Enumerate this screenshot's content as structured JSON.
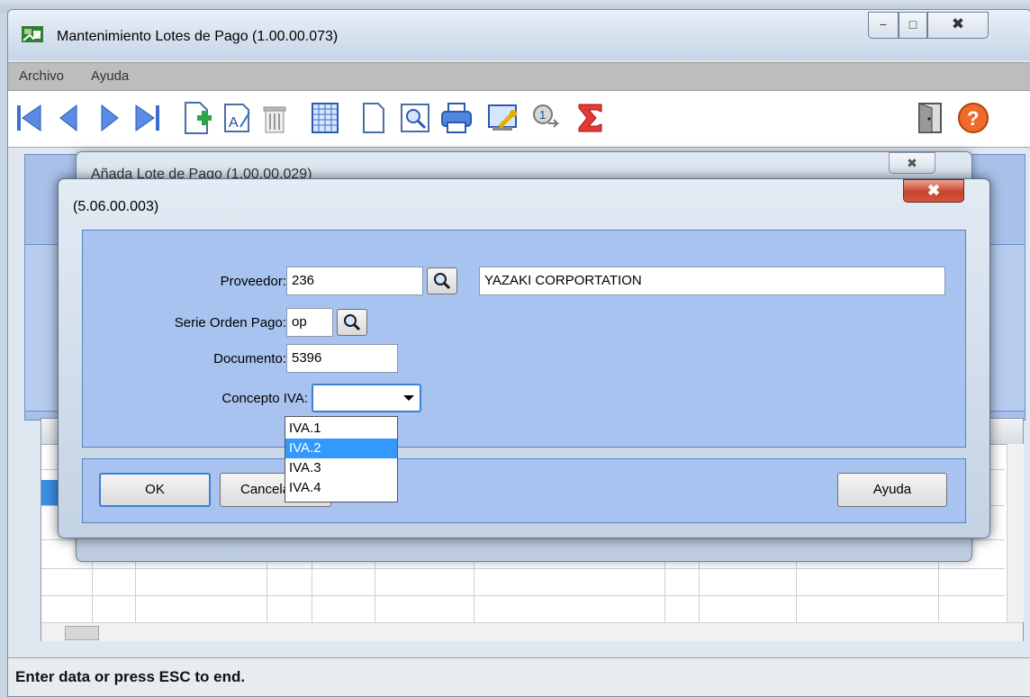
{
  "window": {
    "title": "Mantenimiento Lotes de Pago (1.00.00.073)",
    "controls": {
      "minimize": "−",
      "maximize": "□",
      "close": "✖"
    }
  },
  "menu": {
    "items": [
      "Archivo",
      "Ayuda"
    ]
  },
  "toolbar": {
    "icons": [
      "first-record-icon",
      "previous-record-icon",
      "next-record-icon",
      "last-record-icon",
      "add-record-icon",
      "edit-record-icon",
      "delete-record-icon",
      "grid-view-icon",
      "new-document-icon",
      "print-preview-icon",
      "print-icon",
      "settings-icon",
      "info-icon",
      "sum-icon",
      "exit-door-icon",
      "help-icon"
    ]
  },
  "middle_dialog": {
    "title": "Añada Lote de Pago (1.00.00.029)",
    "close": "✖"
  },
  "dialog": {
    "title": "(5.06.00.003)",
    "close": "✖",
    "proveedor": {
      "label": "Proveedor:",
      "code": "236",
      "name": "YAZAKI CORPORTATION"
    },
    "serie": {
      "label": "Serie Orden Pago:",
      "value": "op"
    },
    "documento": {
      "label": "Documento:",
      "value": "5396"
    },
    "concepto": {
      "label": "Concepto IVA:",
      "value": "",
      "options": [
        "IVA.1",
        "IVA.2",
        "IVA.3",
        "IVA.4"
      ],
      "highlighted": "IVA.2"
    },
    "buttons": {
      "ok": "OK",
      "cancel": "Cancelar",
      "help": "Ayuda"
    }
  },
  "status_bar": {
    "text": "Enter data or press ESC to end."
  },
  "colors": {
    "panel": "#a8c3f0",
    "selection": "#3399ff",
    "close_red": "#c6432c"
  }
}
